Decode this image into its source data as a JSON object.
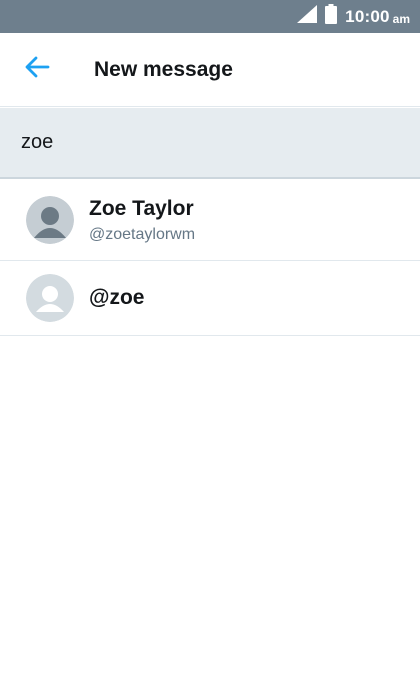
{
  "status_bar": {
    "time": "10:00",
    "ampm": "am",
    "icons": [
      "signal-icon",
      "battery-icon"
    ],
    "background_color": "#6e7f8d"
  },
  "header": {
    "back_icon": "arrow-left-icon",
    "title": "New message",
    "accent_color": "#1da1f2"
  },
  "search": {
    "value": "zoe"
  },
  "results": [
    {
      "name": "Zoe Taylor",
      "handle": "@zoetaylorwm",
      "avatar": "default-avatar-dark"
    },
    {
      "name": "@zoe",
      "handle": "",
      "avatar": "default-avatar-light"
    }
  ]
}
